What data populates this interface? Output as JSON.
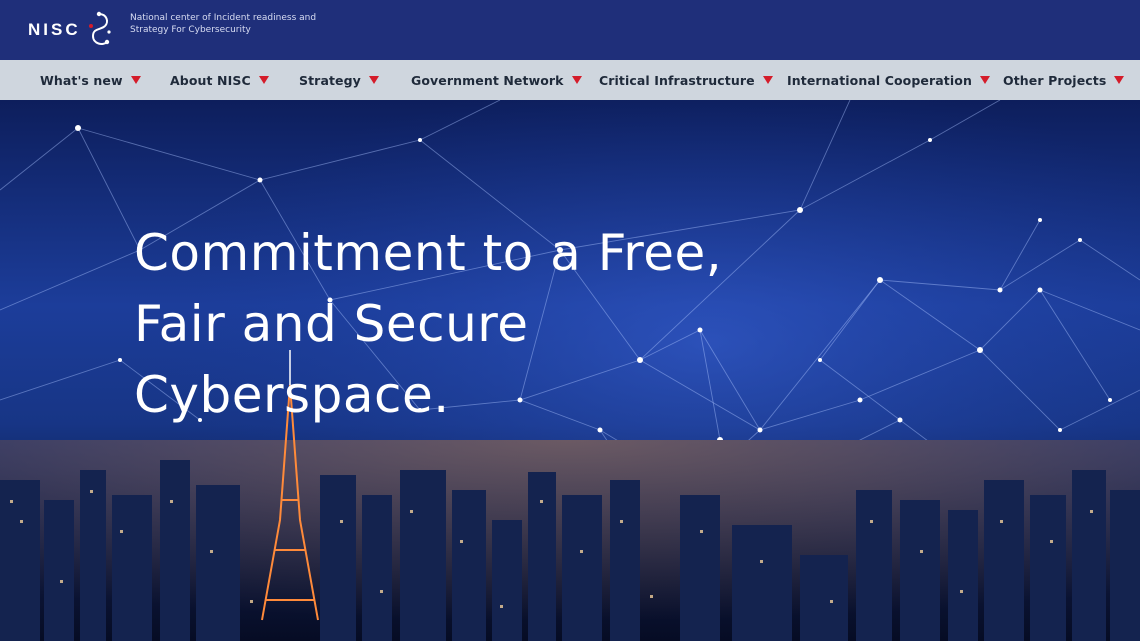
{
  "header": {
    "logo_text": "NISC",
    "logo_icon": "nisc-emblem-icon",
    "tagline_line1": "National center of Incident readiness and",
    "tagline_line2": "Strategy For Cybersecurity",
    "background_color": "#1f2f7a"
  },
  "nav": {
    "background_color": "#cfd6de",
    "caret_color": "#d41c2a",
    "items": [
      {
        "label": "What's new"
      },
      {
        "label": "About NISC"
      },
      {
        "label": "Strategy"
      },
      {
        "label": "Government Network"
      },
      {
        "label": "Critical Infrastructure"
      },
      {
        "label": "International Cooperation"
      },
      {
        "label": "Other Projects"
      }
    ]
  },
  "hero": {
    "headline_line1": "Commitment to a Free,",
    "headline_line2": "Fair and Secure",
    "headline_line3": "Cyberspace.",
    "background_image": "night-city-network-image"
  }
}
